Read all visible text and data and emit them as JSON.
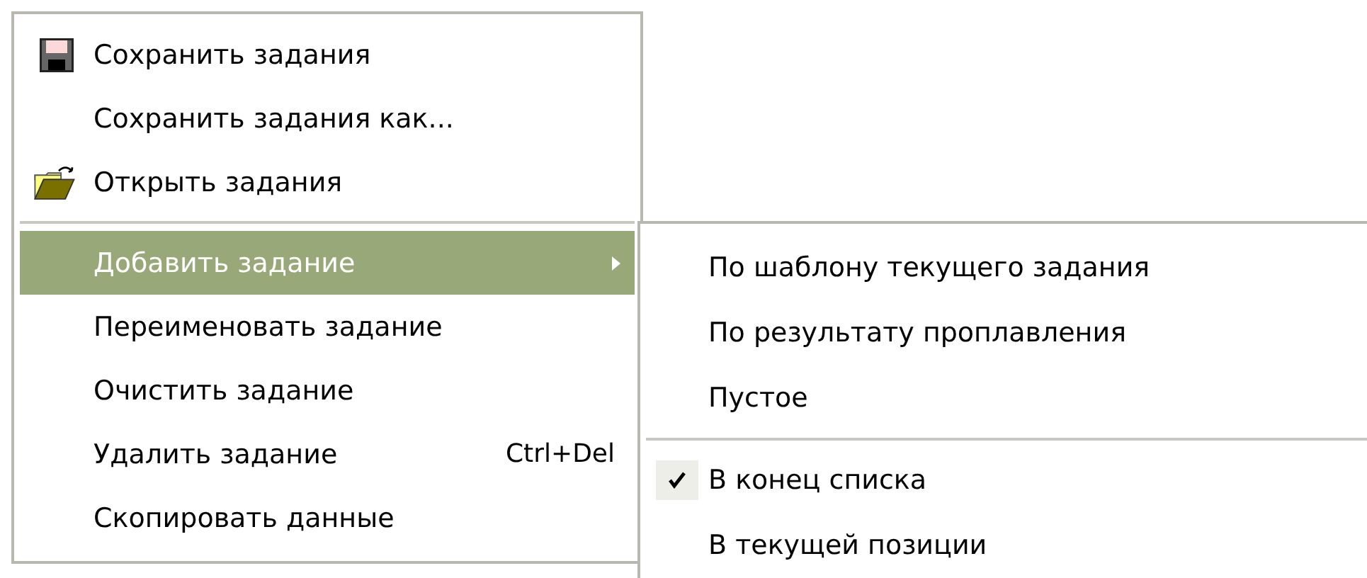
{
  "menu": {
    "items": [
      {
        "kind": "floppy",
        "label": "Сохранить задания",
        "selected": false
      },
      {
        "kind": "plain",
        "label": "Сохранить задания как...",
        "selected": false
      },
      {
        "kind": "folder",
        "label": "Открыть задания",
        "selected": false
      },
      {
        "kind": "separator"
      },
      {
        "kind": "submenu",
        "label": "Добавить задание",
        "selected": true
      },
      {
        "kind": "plain",
        "label": "Переименовать задание",
        "selected": false
      },
      {
        "kind": "plain",
        "label": "Очистить задание",
        "selected": false
      },
      {
        "kind": "plain",
        "label": "Удалить задание",
        "shortcut": "Ctrl+Del",
        "selected": false
      },
      {
        "kind": "plain",
        "label": "Скопировать данные",
        "selected": false
      }
    ]
  },
  "submenu": {
    "items": [
      {
        "kind": "item",
        "label": "По шаблону текущего задания"
      },
      {
        "kind": "item",
        "label": "По результату проплавления"
      },
      {
        "kind": "item",
        "label": "Пустое"
      },
      {
        "kind": "separator"
      },
      {
        "kind": "check",
        "label": "В конец списка",
        "checked": true
      },
      {
        "kind": "check",
        "label": "В текущей позиции",
        "checked": false
      }
    ]
  }
}
